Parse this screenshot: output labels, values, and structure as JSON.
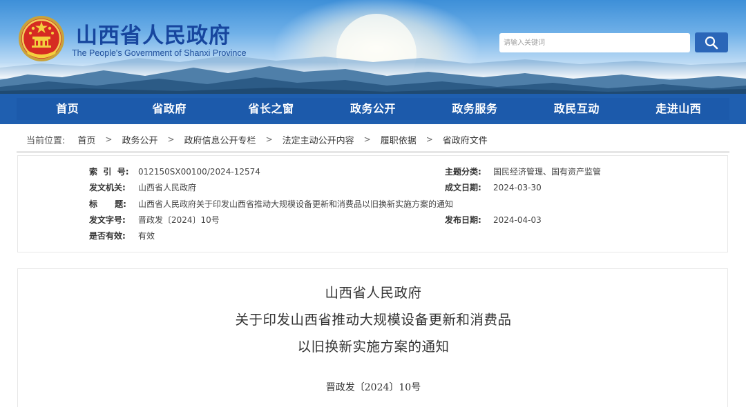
{
  "header": {
    "title": "山西省人民政府",
    "subtitle": "The People's Government of Shanxi Province",
    "emblem_icon": "national-emblem-icon",
    "search": {
      "placeholder": "请输入关键词",
      "button_icon": "search-icon"
    }
  },
  "nav": {
    "items": [
      {
        "label": "首页"
      },
      {
        "label": "省政府"
      },
      {
        "label": "省长之窗"
      },
      {
        "label": "政务公开"
      },
      {
        "label": "政务服务"
      },
      {
        "label": "政民互动"
      },
      {
        "label": "走进山西"
      }
    ]
  },
  "breadcrumb": {
    "prefix": "当前位置:",
    "separator": ">",
    "items": [
      "首页",
      "政务公开",
      "政府信息公开专栏",
      "法定主动公开内容",
      "履职依据",
      "省政府文件"
    ]
  },
  "meta": {
    "index_label": "索  引  号:",
    "index_value": "012150SX00100/2024-12574",
    "topic_label": "主题分类:",
    "topic_value": "国民经济管理、国有资产监管",
    "issuer_label": "发文机关:",
    "issuer_value": "山西省人民政府",
    "date_label": "成文日期:",
    "date_value": "2024-03-30",
    "title_label": "标      题:",
    "title_value": "山西省人民政府关于印发山西省推动大规模设备更新和消费品以旧换新实施方案的通知",
    "docno_label": "发文字号:",
    "docno_value": "晋政发〔2024〕10号",
    "publish_label": "发布日期:",
    "publish_value": "2024-04-03",
    "valid_label": "是否有效:",
    "valid_value": "有效"
  },
  "document": {
    "title_line1": "山西省人民政府",
    "title_line2": "关于印发山西省推动大规模设备更新和消费品",
    "title_line3": "以旧换新实施方案的通知",
    "number": "晋政发〔2024〕10号"
  },
  "colors": {
    "nav_bg": "#1f5fb0",
    "title_blue": "#17469e",
    "search_button": "#2b66b8"
  }
}
